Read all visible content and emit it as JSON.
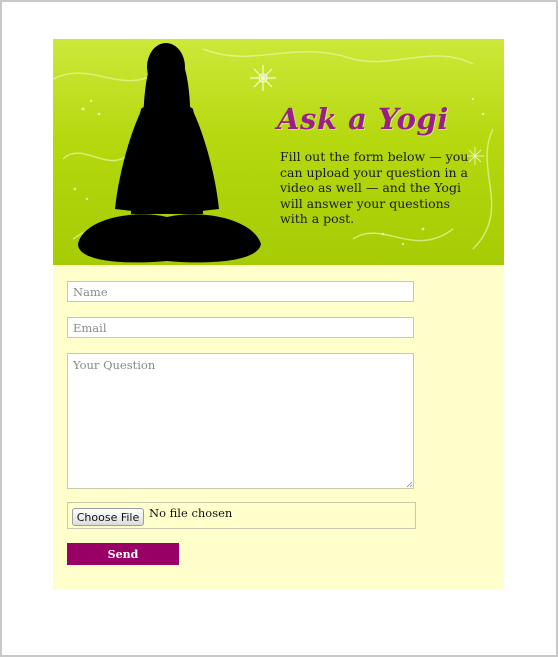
{
  "header": {
    "title": "Ask a Yogi",
    "description": "Fill out the form below — you can upload your question in a video as well — and the Yogi will answer your questions with a post."
  },
  "form": {
    "name_placeholder": "Name",
    "email_placeholder": "Email",
    "question_placeholder": "Your Question",
    "file_button_label": "Choose File",
    "file_status": "No file chosen",
    "send_label": "Send"
  },
  "colors": {
    "brand": "#9b1f8a",
    "send_button": "#990066",
    "hero_green": "#b5d80e",
    "form_background": "#ffffcc"
  },
  "icons": [
    "yogi-silhouette-icon",
    "snowflake-icon"
  ]
}
